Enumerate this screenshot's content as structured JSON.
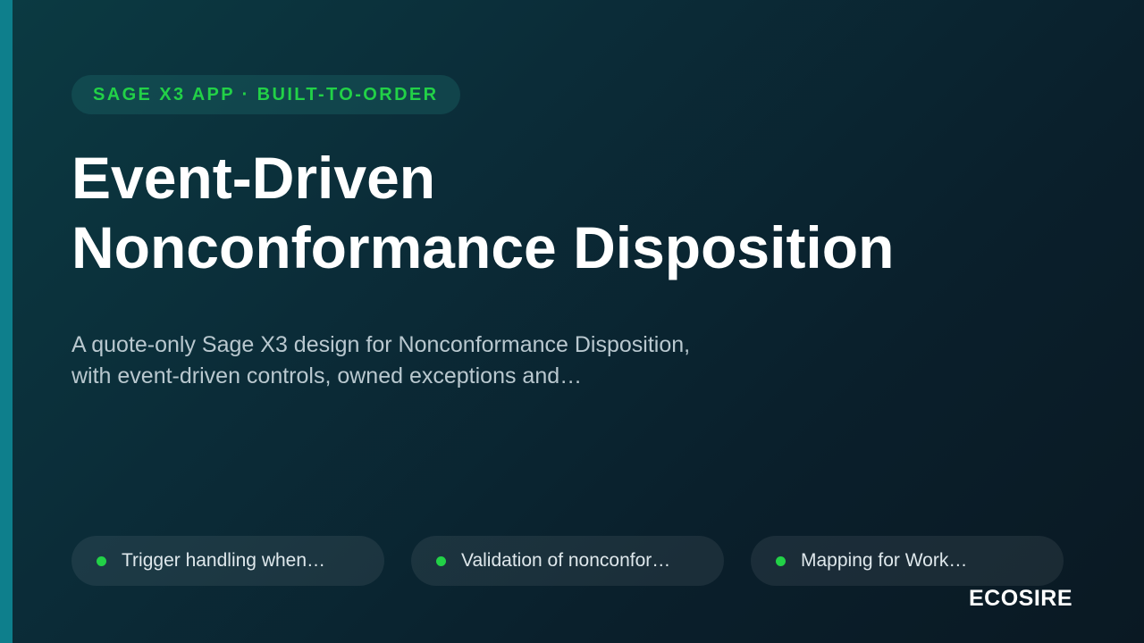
{
  "eyebrow": "SAGE X3 APP · BUILT-TO-ORDER",
  "title": {
    "line1": "Event-Driven",
    "line2": "Nonconformance Disposition"
  },
  "subtitle": {
    "line1": "A quote-only Sage X3 design for Nonconformance Disposition,",
    "line2": "with event-driven controls, owned exceptions and…"
  },
  "features": [
    {
      "label": "Trigger handling when…"
    },
    {
      "label": "Validation of nonconfor…"
    },
    {
      "label": "Mapping for Work…"
    }
  ],
  "brand": "ECOSIRE",
  "colors": {
    "accent_bar": "#0e7f8c",
    "accent_green": "#22d147",
    "background": "#0b2c38"
  },
  "icons": {
    "feature_bullet": "dot-icon"
  }
}
